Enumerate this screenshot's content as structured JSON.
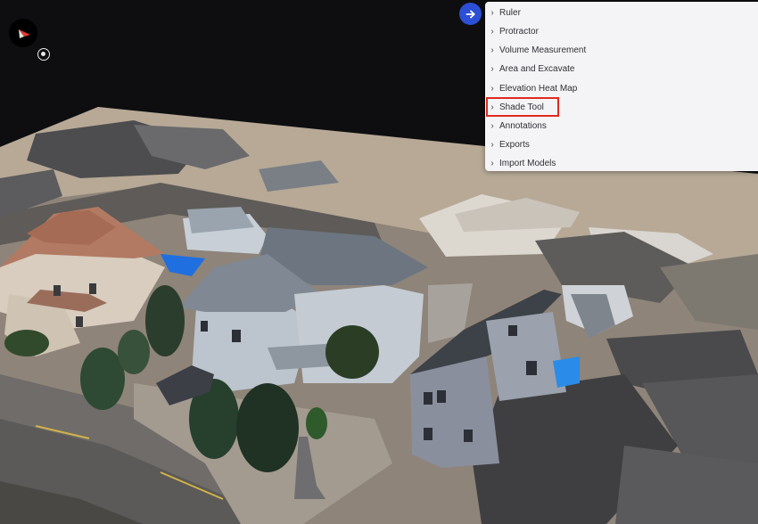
{
  "scene": {
    "compass": {
      "icon": "compass-icon"
    },
    "locate": {
      "icon": "crosshair-icon"
    }
  },
  "panel": {
    "toggle_icon": "arrow-right-icon",
    "toggle_color": "#2c4fd6",
    "highlight_color": "#e02a1f",
    "items": [
      {
        "label": "Ruler"
      },
      {
        "label": "Protractor"
      },
      {
        "label": "Volume Measurement"
      },
      {
        "label": "Area and Excavate"
      },
      {
        "label": "Elevation Heat Map"
      },
      {
        "label": "Shade Tool",
        "highlighted": true
      },
      {
        "label": "Annotations"
      },
      {
        "label": "Exports"
      },
      {
        "label": "Import Models"
      }
    ]
  }
}
